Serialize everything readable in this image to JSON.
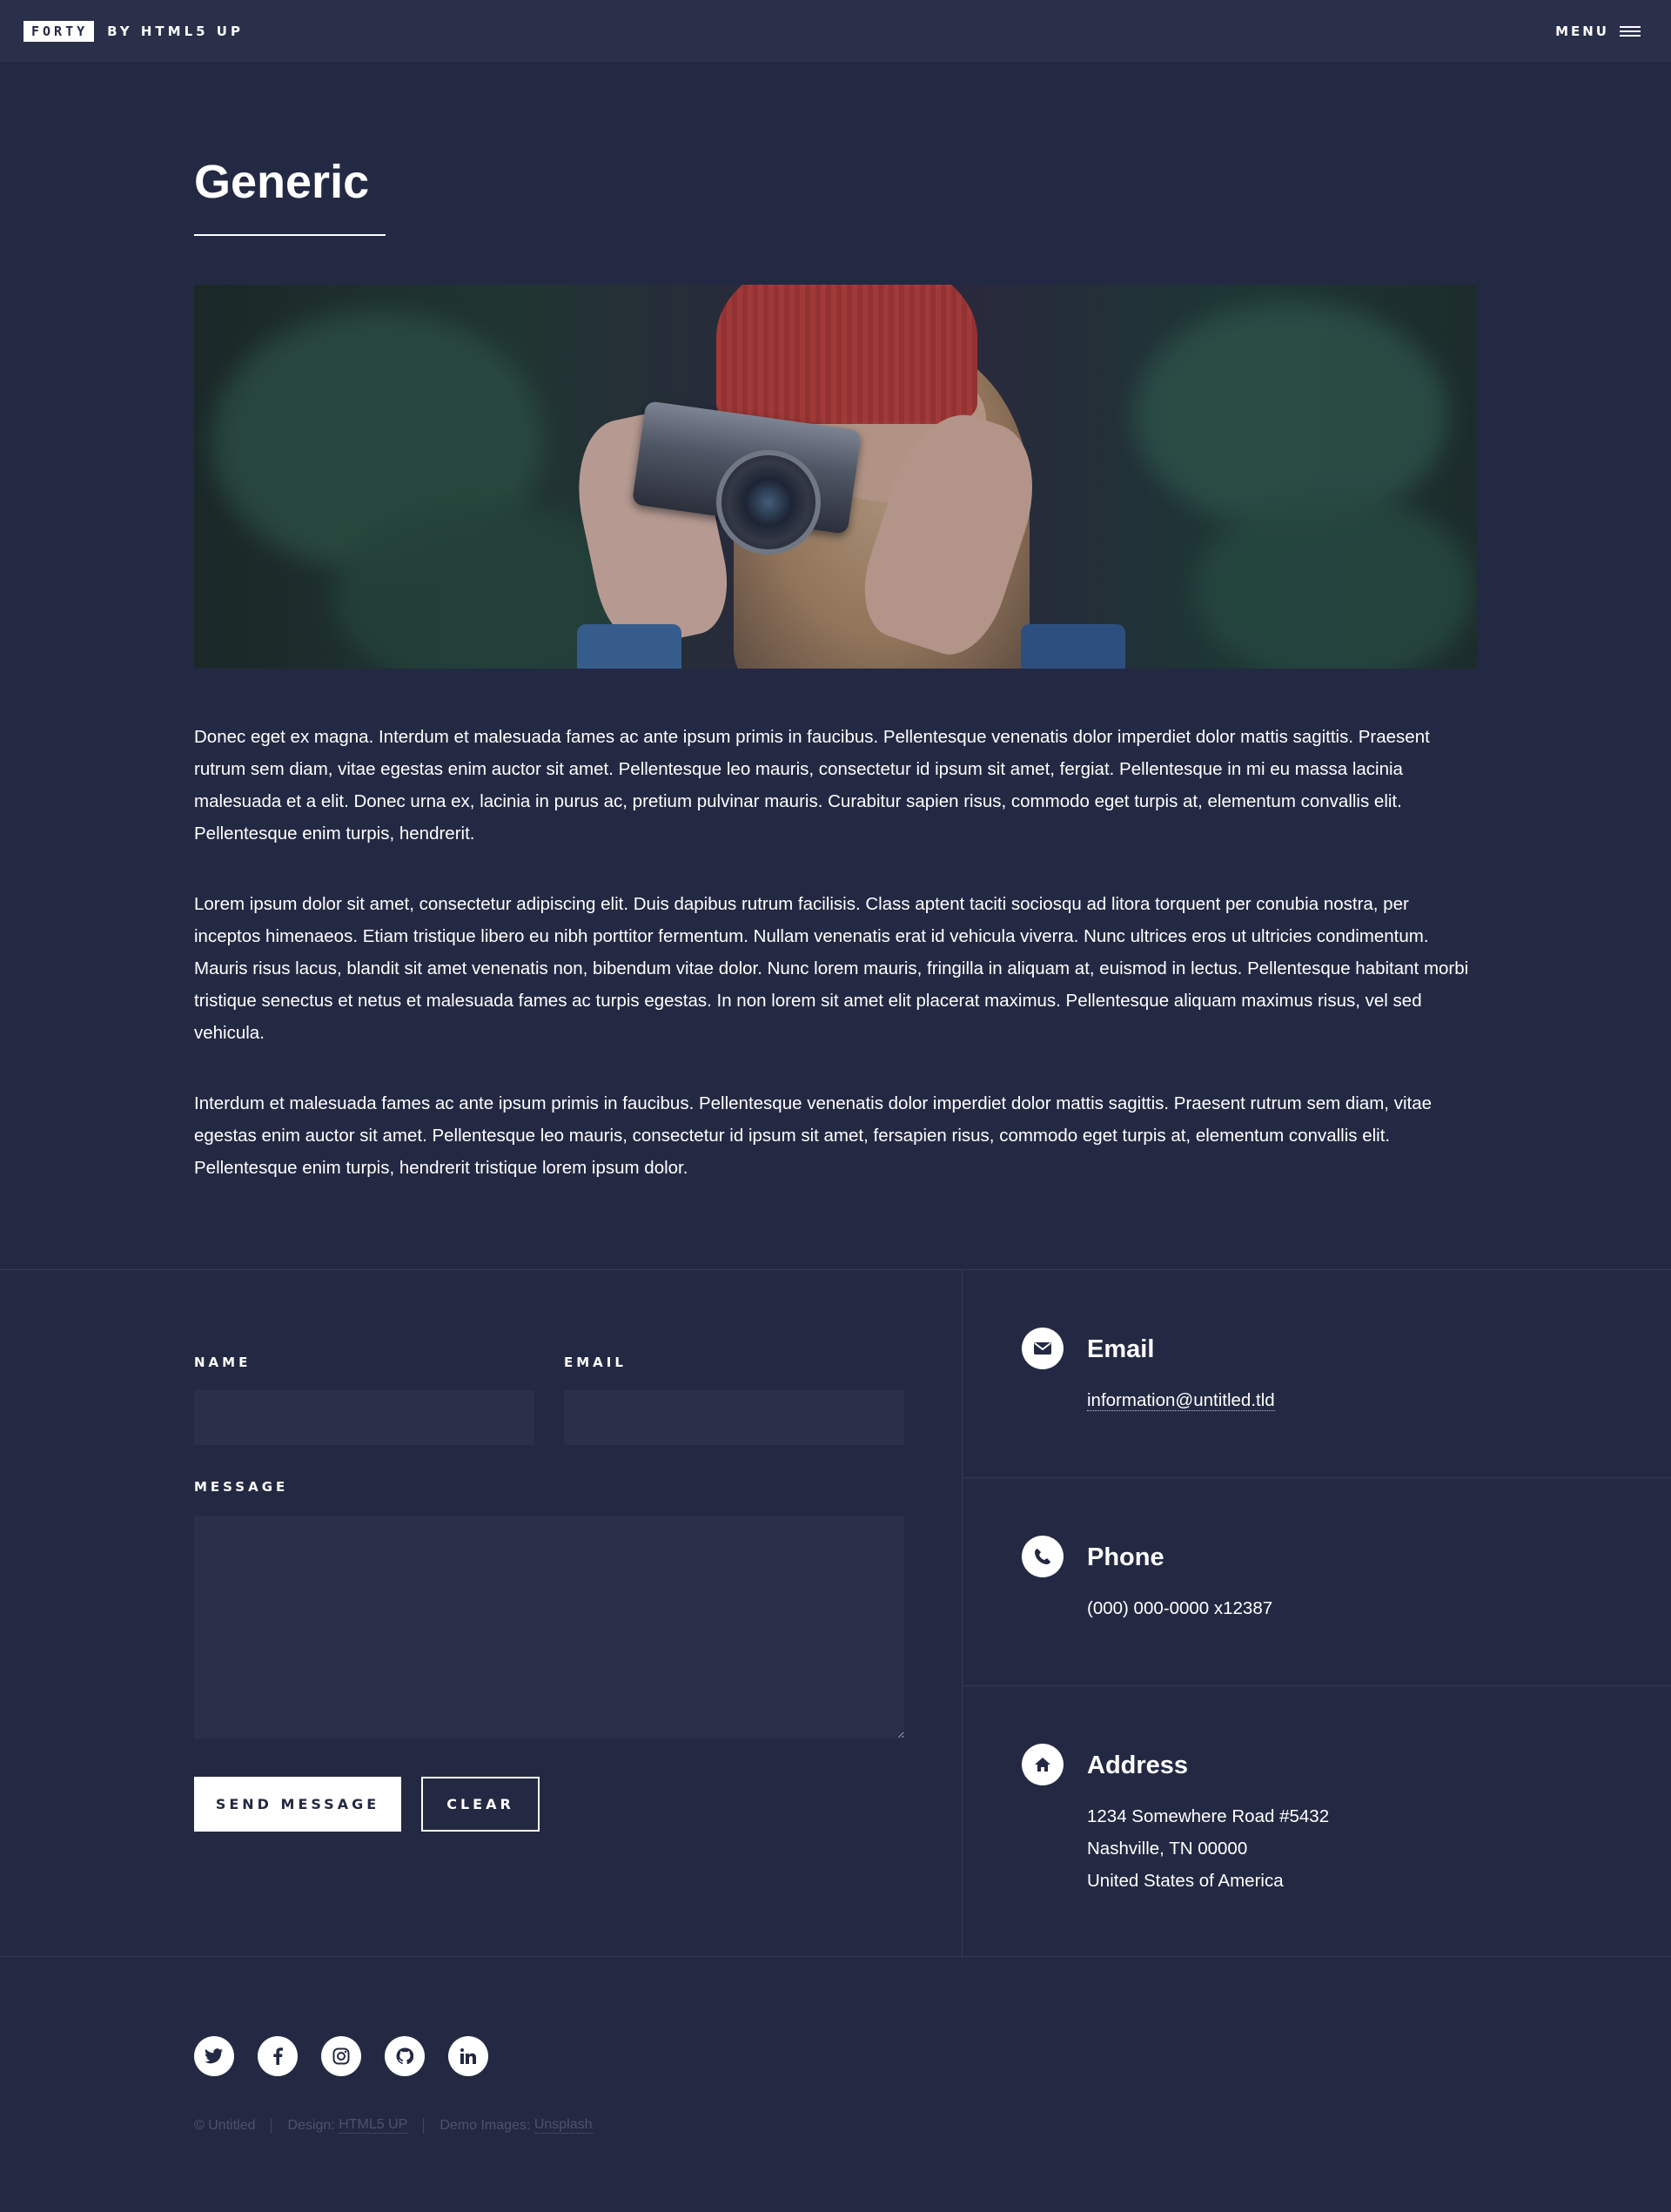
{
  "header": {
    "logo_box": "FORTY",
    "logo_rest": "BY HTML5 UP",
    "menu_label": "MENU"
  },
  "main": {
    "title": "Generic",
    "paragraphs": [
      "Donec eget ex magna. Interdum et malesuada fames ac ante ipsum primis in faucibus. Pellentesque venenatis dolor imperdiet dolor mattis sagittis. Praesent rutrum sem diam, vitae egestas enim auctor sit amet. Pellentesque leo mauris, consectetur id ipsum sit amet, fergiat. Pellentesque in mi eu massa lacinia malesuada et a elit. Donec urna ex, lacinia in purus ac, pretium pulvinar mauris. Curabitur sapien risus, commodo eget turpis at, elementum convallis elit. Pellentesque enim turpis, hendrerit.",
      "Lorem ipsum dolor sit amet, consectetur adipiscing elit. Duis dapibus rutrum facilisis. Class aptent taciti sociosqu ad litora torquent per conubia nostra, per inceptos himenaeos. Etiam tristique libero eu nibh porttitor fermentum. Nullam venenatis erat id vehicula viverra. Nunc ultrices eros ut ultricies condimentum. Mauris risus lacus, blandit sit amet venenatis non, bibendum vitae dolor. Nunc lorem mauris, fringilla in aliquam at, euismod in lectus. Pellentesque habitant morbi tristique senectus et netus et malesuada fames ac turpis egestas. In non lorem sit amet elit placerat maximus. Pellentesque aliquam maximus risus, vel sed vehicula.",
      "Interdum et malesuada fames ac ante ipsum primis in faucibus. Pellentesque venenatis dolor imperdiet dolor mattis sagittis. Praesent rutrum sem diam, vitae egestas enim auctor sit amet. Pellentesque leo mauris, consectetur id ipsum sit amet, fersapien risus, commodo eget turpis at, elementum convallis elit. Pellentesque enim turpis, hendrerit tristique lorem ipsum dolor."
    ]
  },
  "contact_form": {
    "name_label": "NAME",
    "email_label": "EMAIL",
    "message_label": "MESSAGE",
    "name_value": "",
    "email_value": "",
    "message_value": "",
    "send_label": "SEND MESSAGE",
    "clear_label": "CLEAR"
  },
  "contact_info": {
    "email": {
      "title": "Email",
      "value": "information@untitled.tld",
      "icon": "envelope-icon"
    },
    "phone": {
      "title": "Phone",
      "value": "(000) 000-0000 x12387",
      "icon": "phone-icon"
    },
    "address": {
      "title": "Address",
      "line1": "1234 Somewhere Road #5432",
      "line2": "Nashville, TN 00000",
      "line3": "United States of America",
      "icon": "home-icon"
    }
  },
  "footer": {
    "socials": [
      "twitter-icon",
      "facebook-icon",
      "instagram-icon",
      "github-icon",
      "linkedin-icon"
    ],
    "copyright": "© Untitled",
    "design_label": "Design:",
    "design_link": "HTML5 UP",
    "images_label": "Demo Images:",
    "images_link": "Unsplash"
  },
  "colors": {
    "background": "#242943",
    "header_bg": "#2a2f4a",
    "field_bg": "#2a2f4a",
    "text": "#ffffff"
  }
}
